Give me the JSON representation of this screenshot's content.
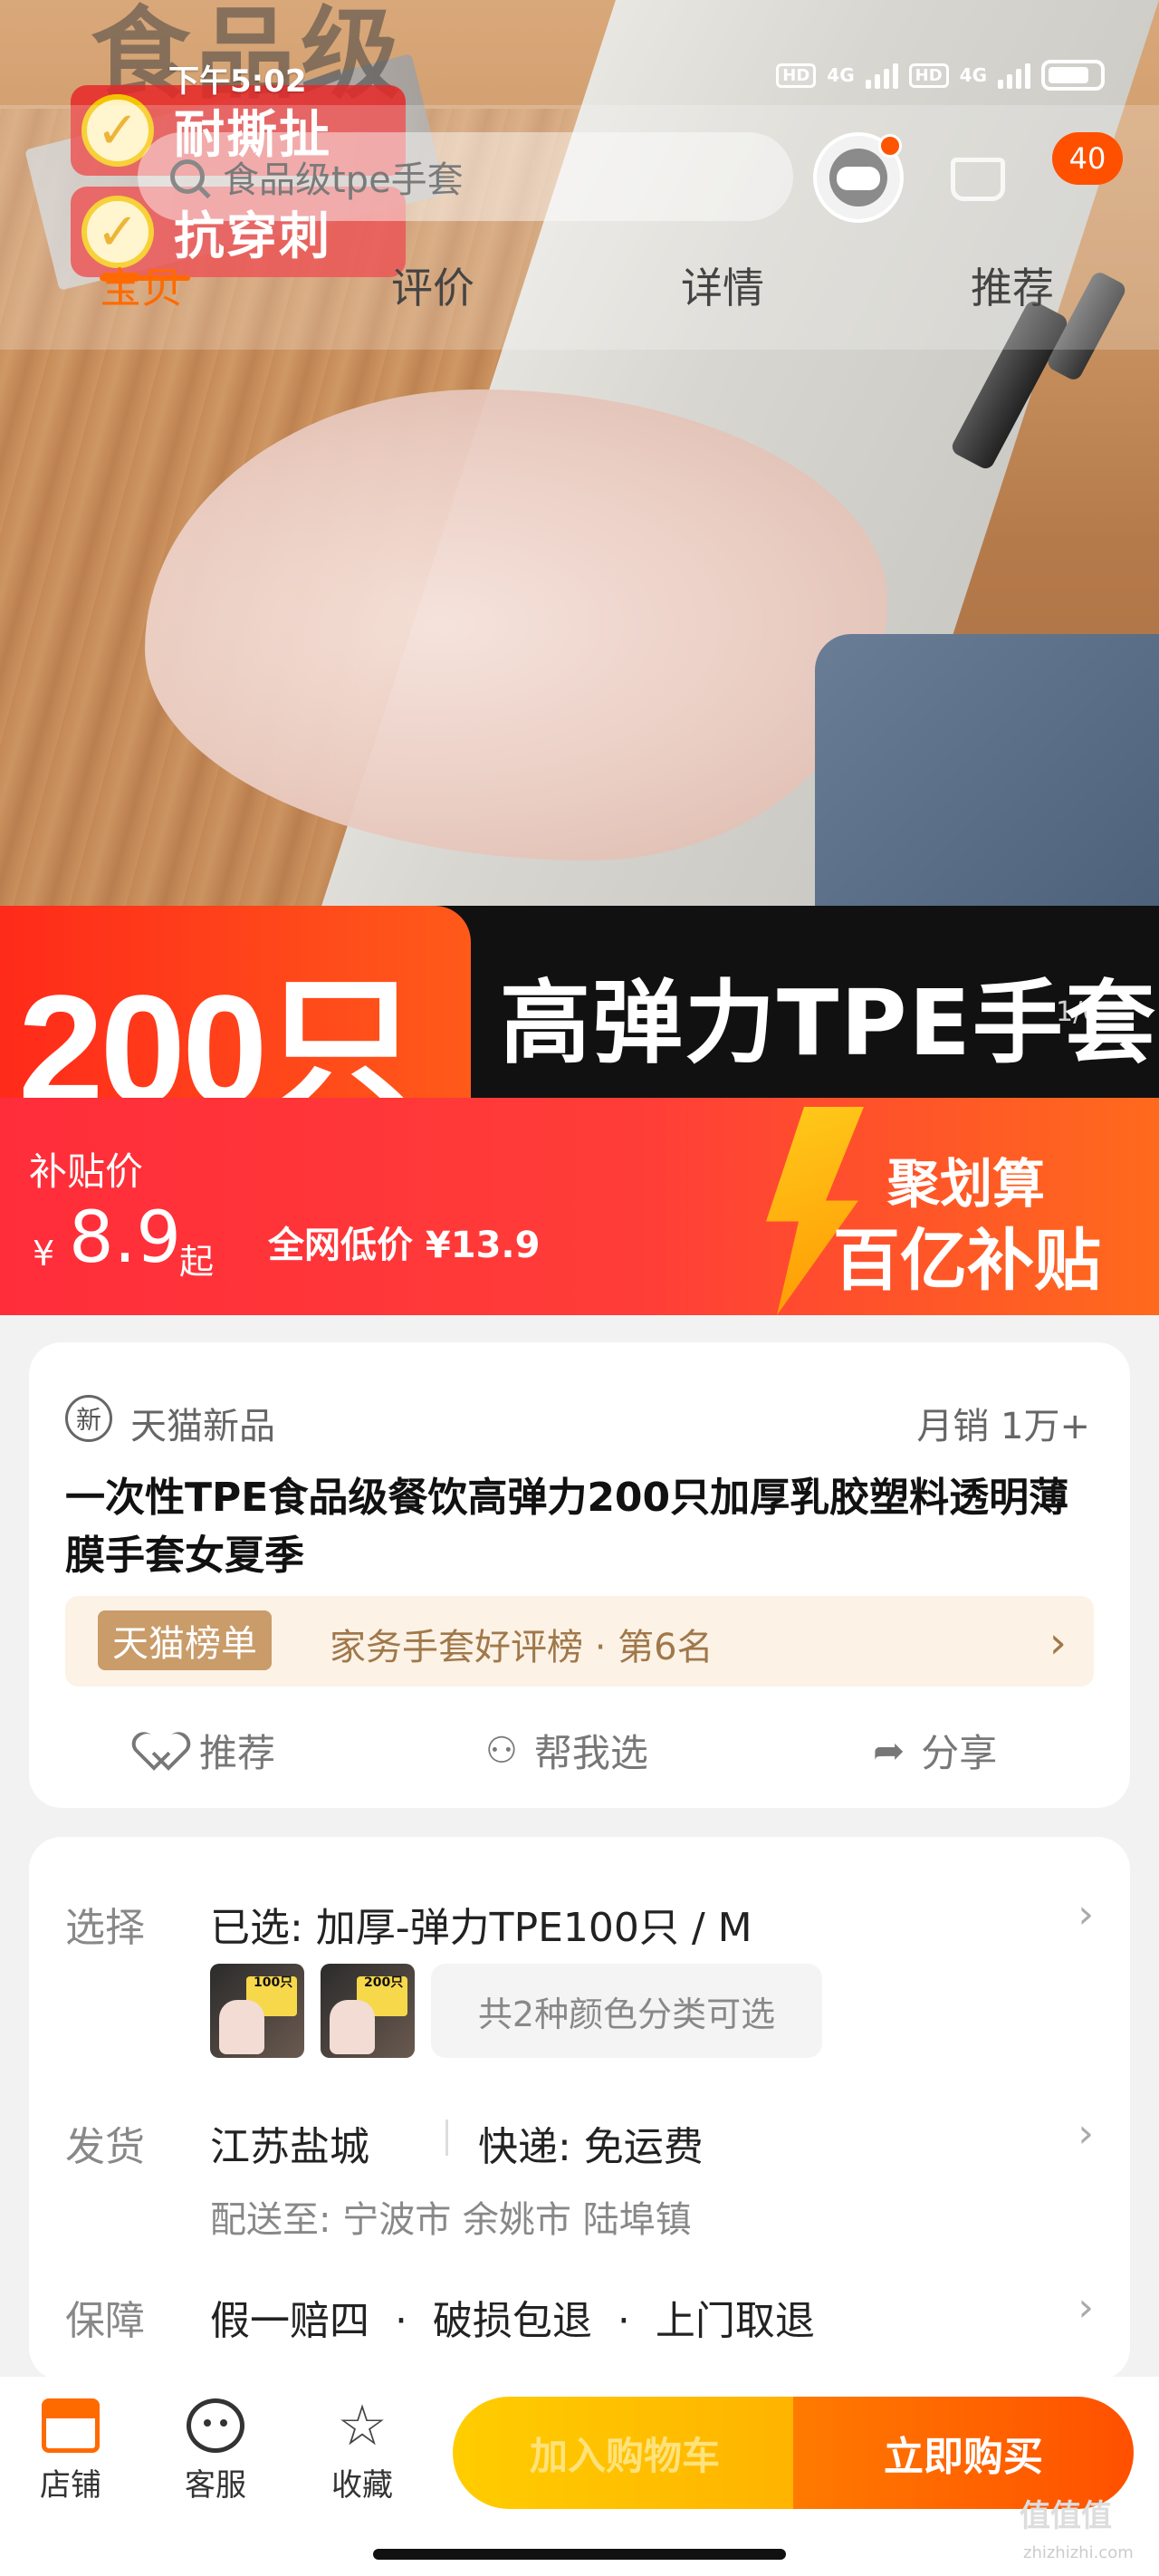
{
  "status": {
    "time": "下午5:02",
    "net1": "4G",
    "net2": "4G",
    "hd": "HD"
  },
  "hero": {
    "watermark_text": "食品级",
    "badges": [
      "耐撕扯",
      "抗穿刺"
    ],
    "check_glyph": "✓"
  },
  "search": {
    "placeholder": "食品级tpe手套"
  },
  "header": {
    "cart_count": "40"
  },
  "tabs": [
    {
      "label": "宝贝",
      "active": true
    },
    {
      "label": "评价",
      "active": false
    },
    {
      "label": "详情",
      "active": false
    },
    {
      "label": "推荐",
      "active": false
    }
  ],
  "banner": {
    "count": "200只",
    "text": "高弹力TPE手套",
    "page": "1/6"
  },
  "price": {
    "label": "补贴价",
    "currency": "¥",
    "value": "8.9",
    "suffix": "起",
    "compare": "全网低价 ¥13.9",
    "promo_line1": "聚划算",
    "promo_line2": "百亿补贴"
  },
  "product": {
    "new_icon": "新",
    "new_label": "天猫新品",
    "sales": "月销 1万+",
    "title": "一次性TPE食品级餐饮高弹力200只加厚乳胶塑料透明薄膜手套女夏季",
    "rank_tag": "天猫榜单",
    "rank_text": "家务手套好评榜 · 第6名",
    "actions": {
      "recommend": "推荐",
      "help_choose": "帮我选",
      "share": "分享"
    }
  },
  "options": {
    "select_label": "选择",
    "selected": "已选: 加厚-弹力TPE100只 / M",
    "thumb1": "100只",
    "thumb2": "200只",
    "color_count": "共2种颜色分类可选",
    "ship_label": "发货",
    "ship_from": "江苏盐城",
    "express": "快递: 免运费",
    "deliver_to": "配送至: 宁波市 余姚市 陆埠镇",
    "guarantee_label": "保障",
    "guarantee": "假一赔四  ·  破损包退  ·  上门取退"
  },
  "bottom": {
    "store": "店铺",
    "service": "客服",
    "favorite": "收藏",
    "add_cart": "加入购物车",
    "buy_now": "立即购买"
  },
  "watermark": {
    "main": "值值值",
    "url": "zhizhizhi.com"
  },
  "colors": {
    "accent": "#ff6a00",
    "price_red": "#ff2d3a",
    "buy_orange": "#ff5000",
    "cart_yellow": "#ffcd00"
  }
}
